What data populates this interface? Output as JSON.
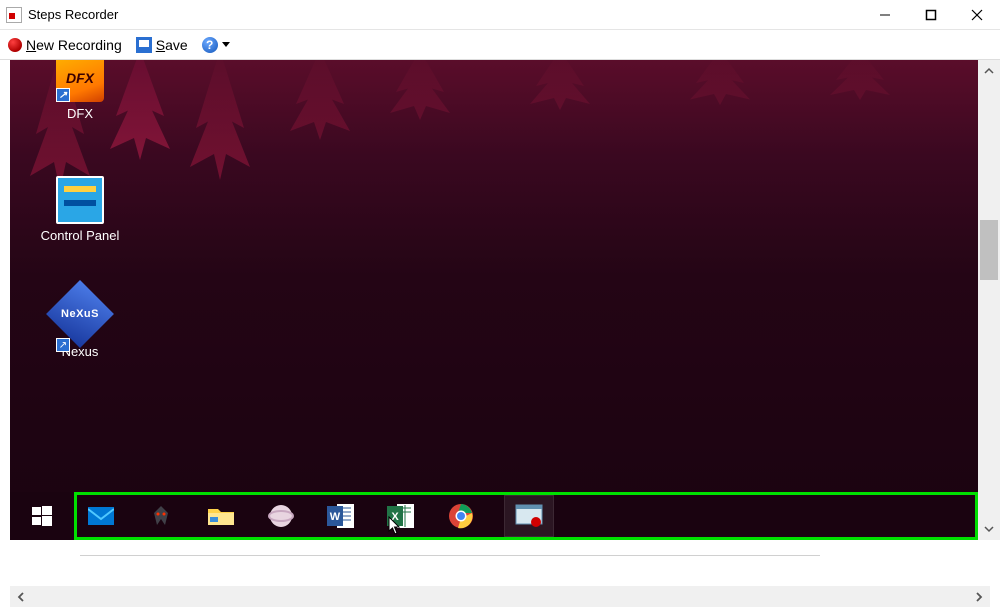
{
  "window": {
    "title": "Steps Recorder"
  },
  "toolbar": {
    "new_recording": "New Recording",
    "save": "Save",
    "help_glyph": "?"
  },
  "desktop_icons": [
    {
      "label": "DFX",
      "badge": "DFX"
    },
    {
      "label": "Control Panel"
    },
    {
      "label": "Nexus",
      "badge": "NeXuS"
    }
  ],
  "taskbar": {
    "items": [
      {
        "name": "mail"
      },
      {
        "name": "predator"
      },
      {
        "name": "file-explorer"
      },
      {
        "name": "skype"
      },
      {
        "name": "word"
      },
      {
        "name": "excel"
      },
      {
        "name": "chrome"
      },
      {
        "name": "steps-recorder",
        "active": true
      }
    ]
  }
}
